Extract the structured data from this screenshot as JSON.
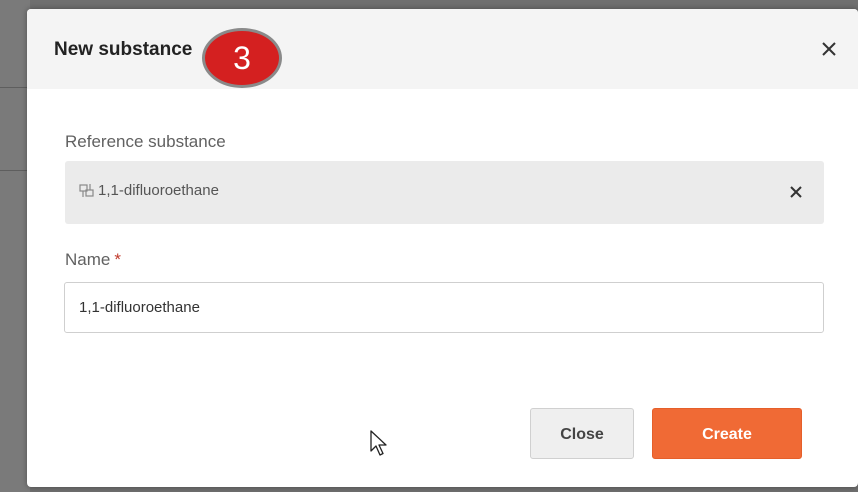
{
  "dialog": {
    "title": "New substance",
    "step_badge": "3",
    "close_icon": "close-icon"
  },
  "reference": {
    "label": "Reference substance",
    "icon": "molecule-icon",
    "value": "1,1-difluoroethane",
    "clear_icon": "clear-icon"
  },
  "name": {
    "label": "Name",
    "required_mark": "*",
    "value": "1,1-difluoroethane",
    "placeholder": ""
  },
  "actions": {
    "close_label": "Close",
    "create_label": "Create"
  },
  "colors": {
    "accent": "#f06a35",
    "badge": "#d42020",
    "required": "#c0392b"
  }
}
